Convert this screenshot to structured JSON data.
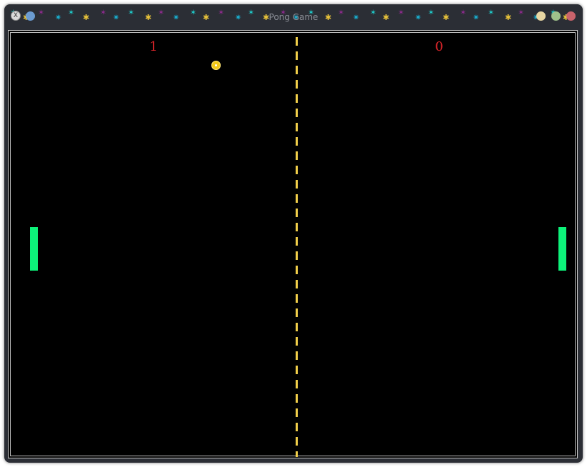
{
  "window": {
    "title": "Pong Game",
    "app_icon": "x-app-icon",
    "buttons": [
      {
        "name": "minimize-button",
        "color": "#e8d7a3"
      },
      {
        "name": "maximize-button",
        "color": "#9fc08b"
      },
      {
        "name": "close-button",
        "color": "#c9636b"
      }
    ],
    "menu_button_color": "#6b9bd1"
  },
  "game": {
    "left_score": "1",
    "right_score": "0",
    "colors": {
      "background": "#000000",
      "paddle": "#0df27a",
      "ball": "#f3c918",
      "divider": "#f1cf4a",
      "score": "#e2262b"
    }
  }
}
